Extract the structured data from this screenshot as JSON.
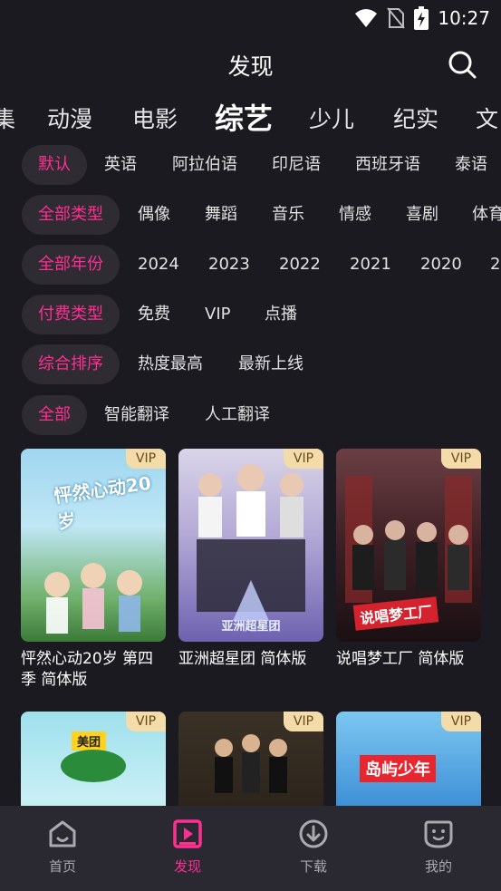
{
  "status_bar": {
    "time": "10:27"
  },
  "header": {
    "title": "发现"
  },
  "categories": [
    "集",
    "动漫",
    "电影",
    "综艺",
    "少儿",
    "纪实",
    "文"
  ],
  "active_category": "综艺",
  "filters": [
    {
      "active": "默认",
      "options": [
        "英语",
        "阿拉伯语",
        "印尼语",
        "西班牙语",
        "泰语"
      ]
    },
    {
      "active": "全部类型",
      "options": [
        "偶像",
        "舞蹈",
        "音乐",
        "情感",
        "喜剧",
        "体育"
      ]
    },
    {
      "active": "全部年份",
      "options": [
        "2024",
        "2023",
        "2022",
        "2021",
        "2020",
        "2"
      ]
    },
    {
      "active": "付费类型",
      "options": [
        "免费",
        "VIP",
        "点播"
      ]
    },
    {
      "active": "综合排序",
      "options": [
        "热度最高",
        "最新上线"
      ]
    },
    {
      "active": "全部",
      "options": [
        "智能翻译",
        "人工翻译"
      ]
    }
  ],
  "cards": [
    {
      "badge": "VIP",
      "title": "怦然心动20岁 第四季 简体版",
      "poster_text": "怦然心动20岁"
    },
    {
      "badge": "VIP",
      "title": "亚洲超星团 简体版",
      "poster_text": "亚洲超星团"
    },
    {
      "badge": "VIP",
      "title": "说唱梦工厂 简体版",
      "poster_text": "说唱梦工厂"
    },
    {
      "badge": "VIP",
      "title": "",
      "poster_text": "美团"
    },
    {
      "badge": "VIP",
      "title": "",
      "poster_text": ""
    },
    {
      "badge": "VIP",
      "title": "",
      "poster_text": "岛屿少年"
    }
  ],
  "nav": [
    {
      "label": "首页",
      "icon": "home-icon"
    },
    {
      "label": "发现",
      "icon": "discover-icon"
    },
    {
      "label": "下载",
      "icon": "download-icon"
    },
    {
      "label": "我的",
      "icon": "profile-icon"
    }
  ],
  "colors": {
    "accent": "#ff2f92",
    "background": "#1b1a20",
    "vip_badge": "#f3dca9",
    "nav_bg": "#2a2830"
  }
}
